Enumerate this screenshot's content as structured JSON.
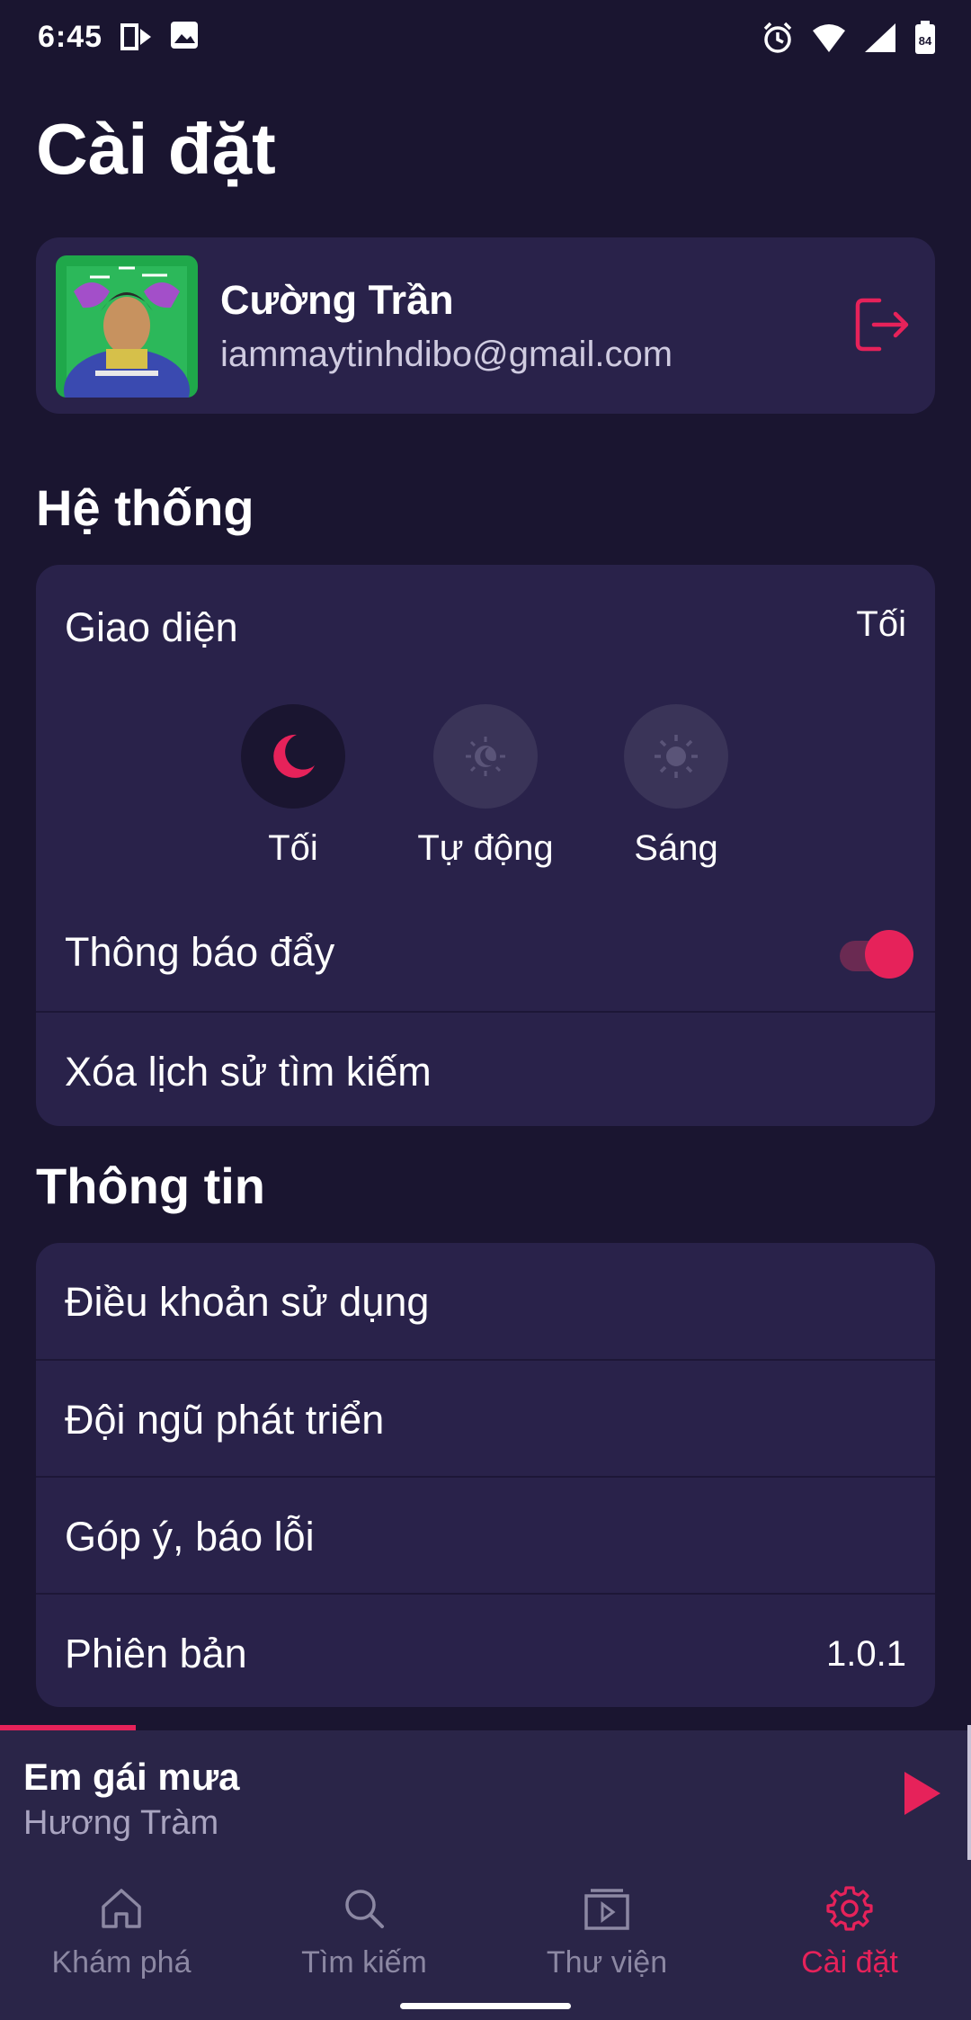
{
  "status_bar": {
    "time": "6:45",
    "icons": [
      "media-icon",
      "image-icon",
      "alarm-icon",
      "wifi-icon",
      "signal-icon",
      "battery-icon"
    ],
    "battery": "84"
  },
  "page": {
    "title": "Cài đặt"
  },
  "profile": {
    "name": "Cường Trần",
    "email": "iammaytinhdibo@gmail.com",
    "avatar_icon": "album-art-avatar",
    "logout_icon": "logout-icon"
  },
  "system": {
    "title": "Hệ thống",
    "appearance": {
      "label": "Giao diện",
      "value": "Tối",
      "options": [
        {
          "label": "Tối",
          "icon": "moon-icon",
          "selected": true
        },
        {
          "label": "Tự động",
          "icon": "auto-theme-icon",
          "selected": false
        },
        {
          "label": "Sáng",
          "icon": "sun-icon",
          "selected": false
        }
      ]
    },
    "push_notifications": {
      "label": "Thông báo đẩy",
      "enabled": true
    },
    "clear_search_history": {
      "label": "Xóa lịch sử tìm kiếm"
    }
  },
  "info": {
    "title": "Thông tin",
    "rows": [
      {
        "label": "Điều khoản sử dụng",
        "value": ""
      },
      {
        "label": "Đội ngũ phát triển",
        "value": ""
      },
      {
        "label": "Góp ý, báo lỗi",
        "value": ""
      },
      {
        "label": "Phiên bản",
        "value": "1.0.1"
      }
    ]
  },
  "player": {
    "title": "Em gái mưa",
    "artist": "Hương Tràm",
    "progress": 0.14,
    "play_icon": "play-icon"
  },
  "nav": {
    "items": [
      {
        "label": "Khám phá",
        "icon": "home-icon",
        "active": false
      },
      {
        "label": "Tìm kiếm",
        "icon": "search-icon",
        "active": false
      },
      {
        "label": "Thư viện",
        "icon": "library-icon",
        "active": false
      },
      {
        "label": "Cài đặt",
        "icon": "gear-icon",
        "active": true
      }
    ]
  },
  "colors": {
    "background": "#1a1530",
    "card": "#29224a",
    "accent": "#e6225a",
    "inactive": "#8c88a3"
  }
}
